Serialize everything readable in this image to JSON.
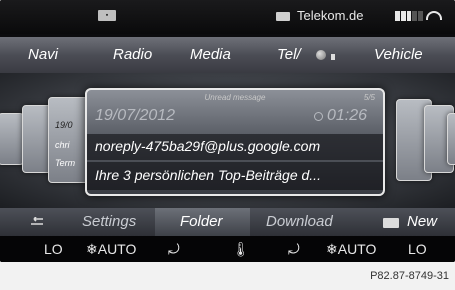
{
  "status_bar": {
    "sim_label": "SIM",
    "network_name": "Telekom.de",
    "signal_bars_on": 3,
    "signal_bars_total": 5
  },
  "main_menu": {
    "items": [
      "Navi",
      "Radio",
      "Media",
      "Tel/",
      "Vehicle"
    ],
    "selected": "Tel/"
  },
  "background_cards": {
    "left_inner": [
      "19/0",
      "chri",
      "Term"
    ]
  },
  "message_card": {
    "header": "Unread message",
    "page_indicator": "5/5",
    "date": "19/07/2012",
    "time": "01:26",
    "from": "noreply-475ba29f@plus.google.com",
    "subject": "Ihre 3 persönlichen Top-Beiträge d..."
  },
  "sub_menu": {
    "back_icon": "back-arrow-icon",
    "settings": "Settings",
    "folder": "Folder",
    "download": "Download",
    "new": "New",
    "selected": "Folder"
  },
  "climate_bar": {
    "left_temp": "LO",
    "left_mode": "AUTO",
    "temp_icon": "thermometer-icon",
    "right_mode": "AUTO",
    "right_temp": "LO"
  },
  "caption": "P82.87-8749-31",
  "colors": {
    "background": "#0c0c0e",
    "menu_bar": "#4b4d55",
    "text": "#ffffff"
  }
}
